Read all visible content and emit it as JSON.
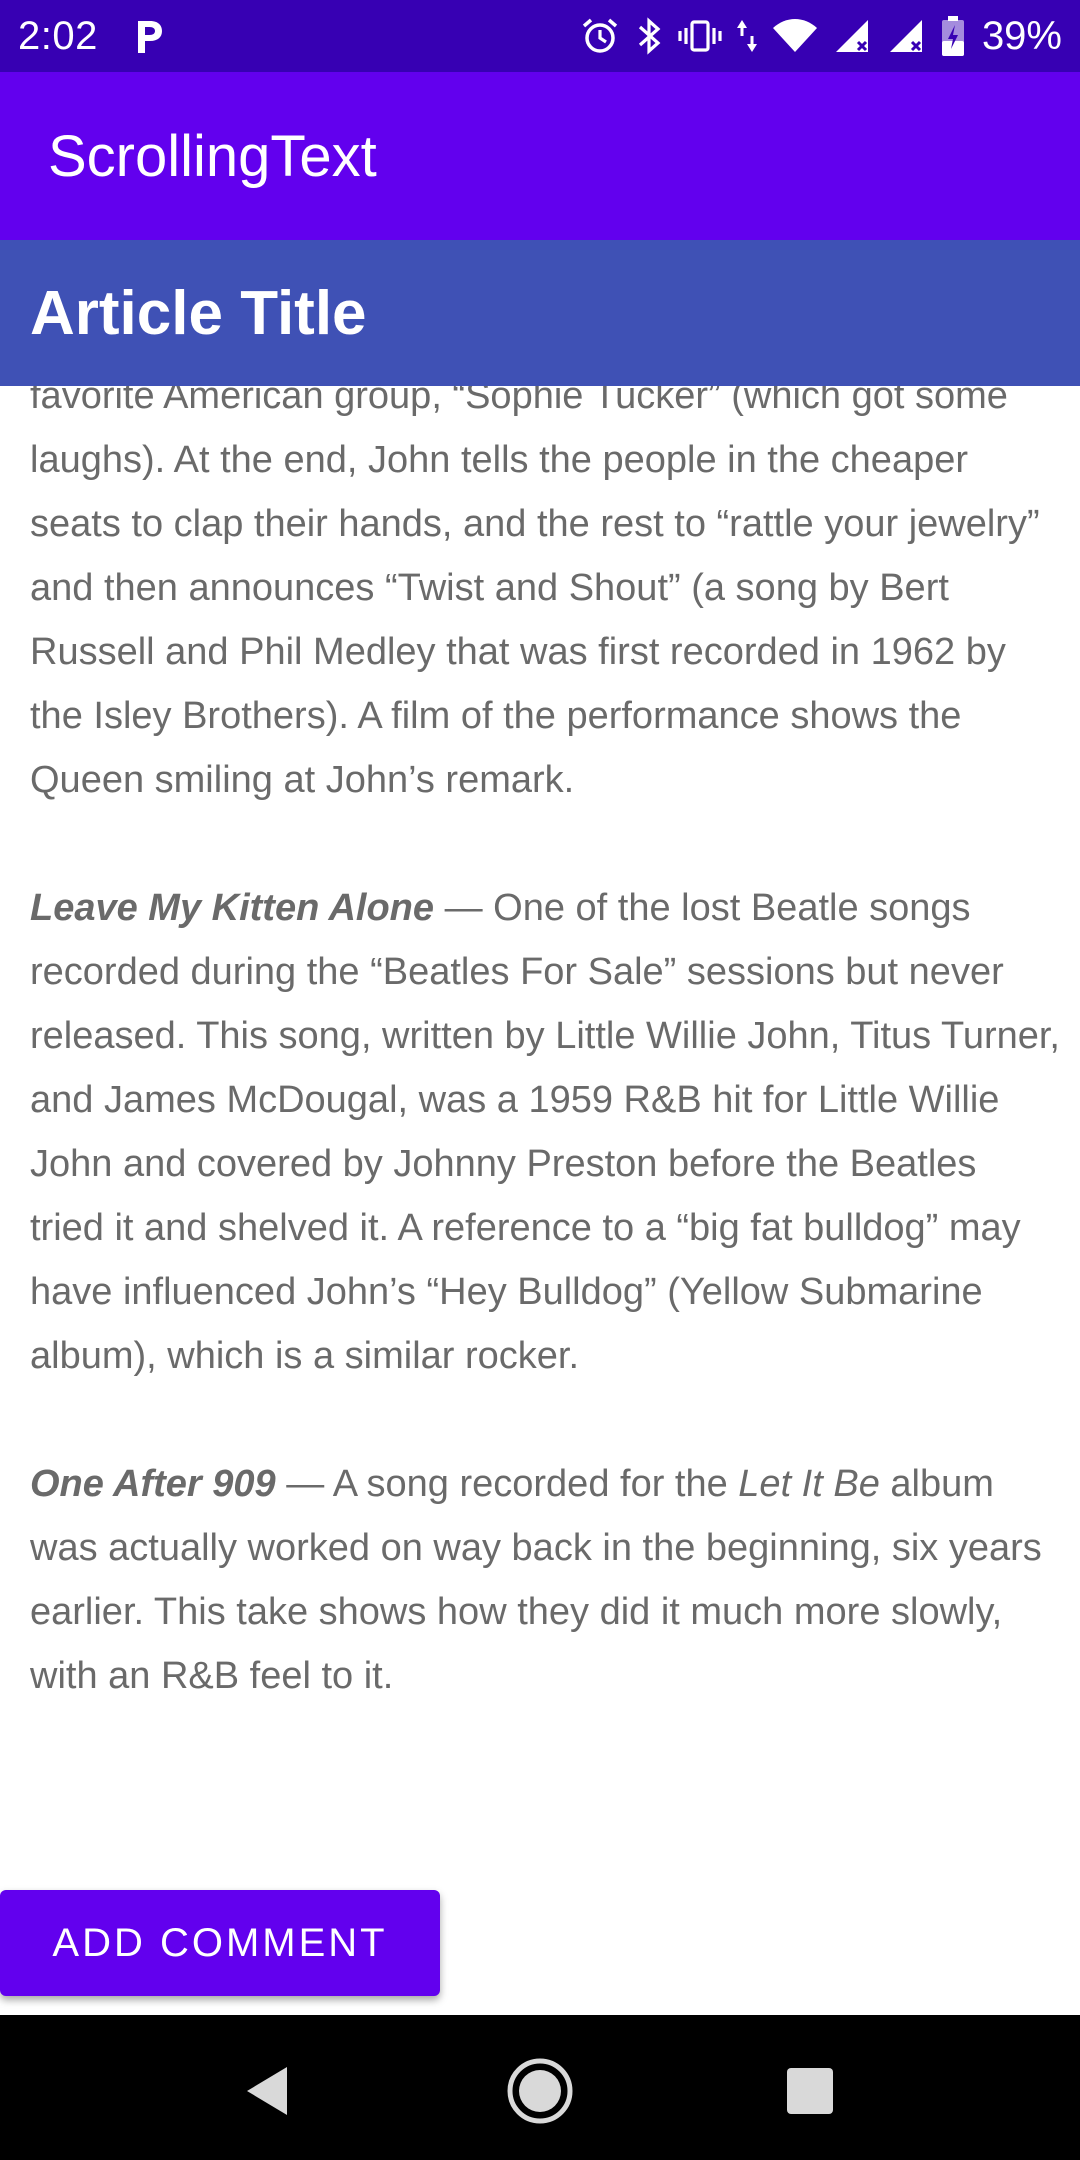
{
  "status_bar": {
    "time": "2:02",
    "battery_percent": "39%",
    "icons": [
      "parking-icon",
      "alarm-icon",
      "bluetooth-icon",
      "vibrate-icon",
      "data-arrows-icon",
      "wifi-icon",
      "signal-icon",
      "signal-icon",
      "battery-charging-icon"
    ]
  },
  "app_bar": {
    "title": "ScrollingText"
  },
  "article": {
    "heading": "Article Title",
    "paragraph_1": "favorite American group, “Sophie Tucker” (which got some laughs). At the end, John tells the people in the cheaper seats to clap their hands, and the rest to “rattle your jewelry” and then announces “Twist and Shout” (a song by Bert Russell and Phil Medley that was first recorded in 1962 by the Isley Brothers). A film of the performance shows the Queen smiling at John’s remark.",
    "song_2_title": "Leave My Kitten Alone",
    "song_2_text": " — One of the lost Beatle songs recorded during the “Beatles For Sale” sessions but never released. This song, written by Little Willie John, Titus Turner, and James McDougal, was a 1959 R&B hit for Little Willie John and covered by Johnny Preston before the Beatles tried it and shelved it. A reference to a “big fat bulldog” may have influenced John’s “Hey Bulldog” (Yellow Submarine album), which is a similar rocker.",
    "song_3_title": "One After 909",
    "song_3_text_before": " — A song recorded for the ",
    "song_3_album": "Let It Be",
    "song_3_text_after": " album was actually worked on way back in the beginning, six years earlier. This take shows how they did it much more slowly, with an R&B feel to it."
  },
  "actions": {
    "add_comment_label": "ADD COMMENT"
  },
  "nav_bar": {
    "icons": [
      "back-icon",
      "home-icon",
      "recents-icon"
    ]
  },
  "colors": {
    "status_bar": "#3700b3",
    "app_bar": "#6200ee",
    "heading_bar": "#3f51b5",
    "body_text": "#6a6a6a",
    "button": "#6200ee"
  }
}
